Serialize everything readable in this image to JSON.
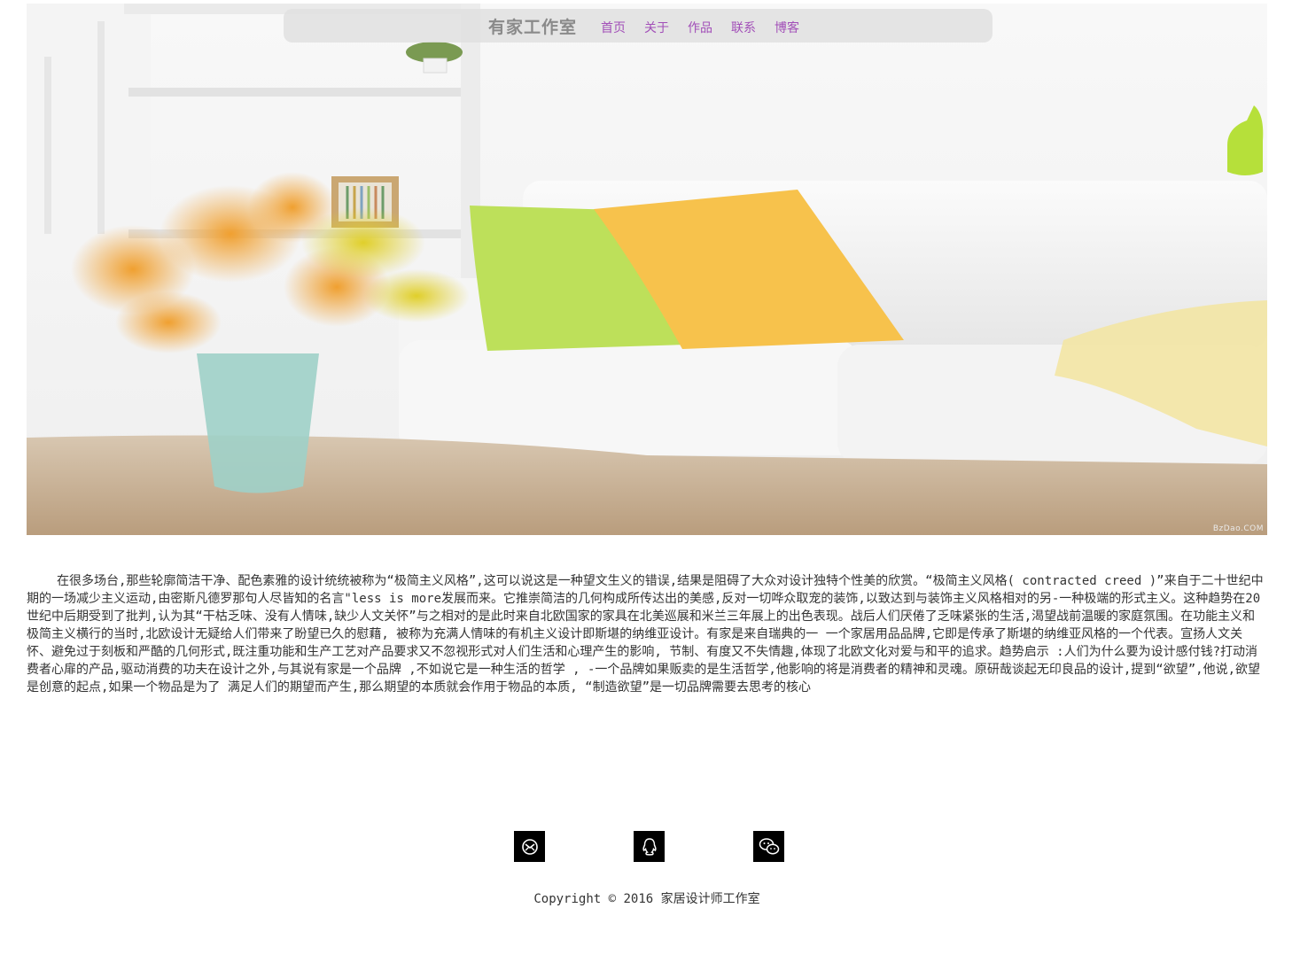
{
  "nav": {
    "brand": "有家工作室",
    "links": [
      "首页",
      "关于",
      "作品",
      "联系",
      "博客"
    ]
  },
  "hero": {
    "image_description": "living room photo",
    "watermark": "BzDao.COM"
  },
  "article": {
    "text": "在很多场台,那些轮廓简洁干净、配色素雅的设计统统被称为“极简主义风格”,这可以说这是一种望文生义的错误,结果是阻碍了大众对设计独特个性美的欣赏。“极简主义风格( contracted creed )”来自于二十世纪中期的一场减少主义运动,由密斯凡德罗那句人尽皆知的名言\"less is more发展而来。它推崇简洁的几何构成所传达出的美感,反对一切哗众取宠的装饰,以致达到与装饰主义风格相对的另-一种极端的形式主义。这种趋势在20世纪中后期受到了批判,认为其“干枯乏味、没有人情味,缺少人文关怀”与之相对的是此时来自北欧国家的家具在北美巡展和米兰三年展上的出色表现。战后人们厌倦了乏味紧张的生活,渴望战前温暖的家庭氛围。在功能主义和极简主义横行的当时,北欧设计无疑给人们带来了盼望已久的慰藉, 被称为充满人情味的有机主义设计即斯堪的纳维亚设计。有家是来自瑞典的一 一个家居用品品牌,它即是传承了斯堪的纳维亚风格的一个代表。宣扬人文关怀、避免过于刻板和严酷的几何形式,既注重功能和生产工艺对产品要求又不忽视形式对人们生活和心理产生的影响, 节制、有度又不失情趣,体现了北欧文化对爱与和平的追求。趋势启示 :人们为什么要为设计感付钱?打动消费者心扉的产品,驱动消费的功夫在设计之外,与其说有家是一个品牌 ,不如说它是一种生活的哲学 , -一个品牌如果贩卖的是生活哲学,他影响的将是消费者的精神和灵魂。原研哉谈起无印良品的设计,提到“欲望”,他说,欲望是创意的起点,如果一个物品是为了 满足人们的期望而产生,那么期望的本质就会作用于物品的本质, “制造欲望”是一切品牌需要去思考的核心"
  },
  "social": {
    "icons": [
      "email-icon",
      "qq-icon",
      "wechat-icon"
    ]
  },
  "footer": {
    "copyright": "Copyright © 2016 家居设计师工作室"
  },
  "colors": {
    "nav_link": "#a24fb8",
    "brand": "#8a8a8a",
    "icon_bg": "#000000"
  }
}
